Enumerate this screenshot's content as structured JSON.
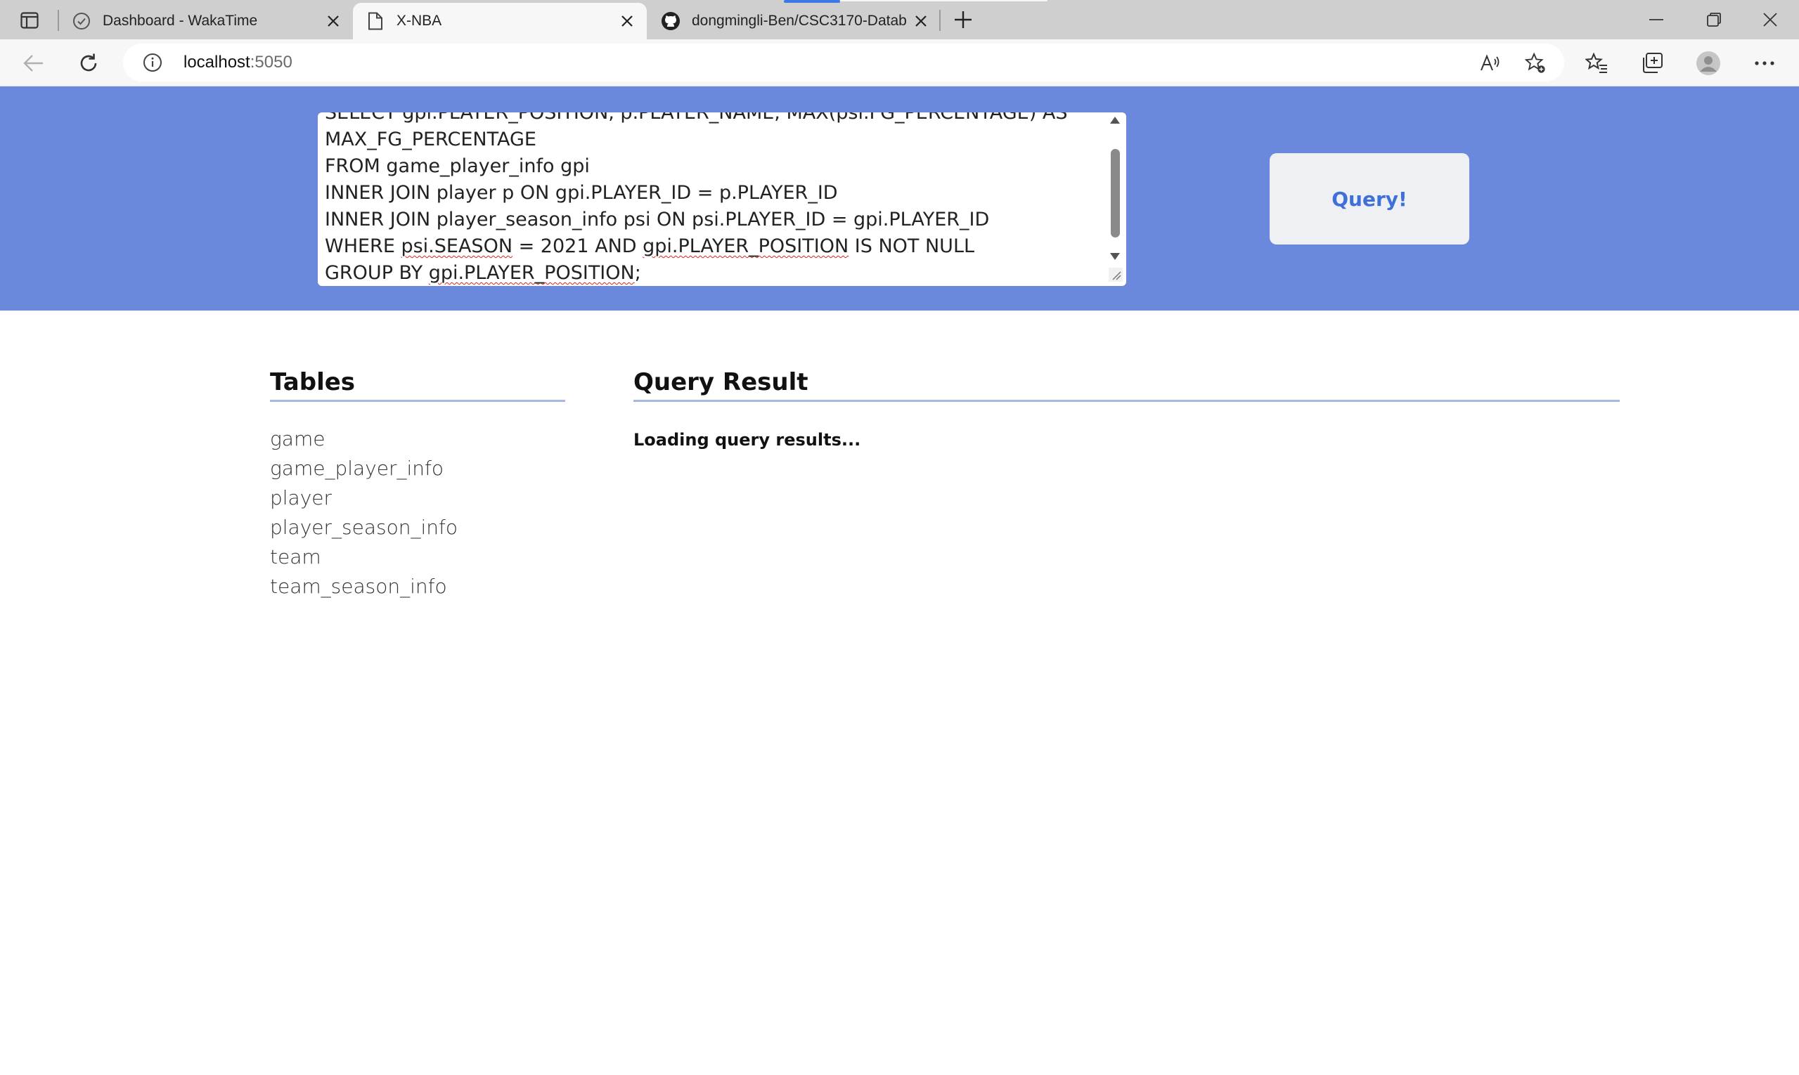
{
  "browser": {
    "tabs": [
      {
        "title": "Dashboard - WakaTime",
        "icon": "check-circle-icon",
        "active": false
      },
      {
        "title": "X-NBA",
        "icon": "page-icon",
        "active": true
      },
      {
        "title": "dongmingli-Ben/CSC3170-Datab",
        "icon": "github-icon",
        "active": false
      }
    ],
    "address": {
      "host": "localhost",
      "port": ":5050"
    }
  },
  "editor": {
    "lines": [
      "SELECT gpi.PLAYER_POSITION, p.PLAYER_NAME, MAX(psi.FG_PERCENTAGE) AS",
      "MAX_FG_PERCENTAGE",
      "FROM game_player_info gpi",
      "INNER JOIN player p ON gpi.PLAYER_ID = p.PLAYER_ID",
      "INNER JOIN player_season_info psi ON psi.PLAYER_ID = gpi.PLAYER_ID"
    ],
    "line6_a": "WHERE ",
    "line6_b": "psi.SEASON",
    "line6_c": " = 2021 AND ",
    "line6_d": "gpi.PLAYER_POSITION",
    "line6_e": " IS NOT NULL",
    "line7_a": "GROUP BY ",
    "line7_b": "gpi.PLAYER_POSITION",
    "line7_c": ";"
  },
  "query_button": "Query!",
  "tables_section": {
    "title": "Tables",
    "items": [
      "game",
      "game_player_info",
      "player",
      "player_season_info",
      "team",
      "team_season_info"
    ]
  },
  "result_section": {
    "title": "Query Result",
    "status": "Loading query results..."
  }
}
